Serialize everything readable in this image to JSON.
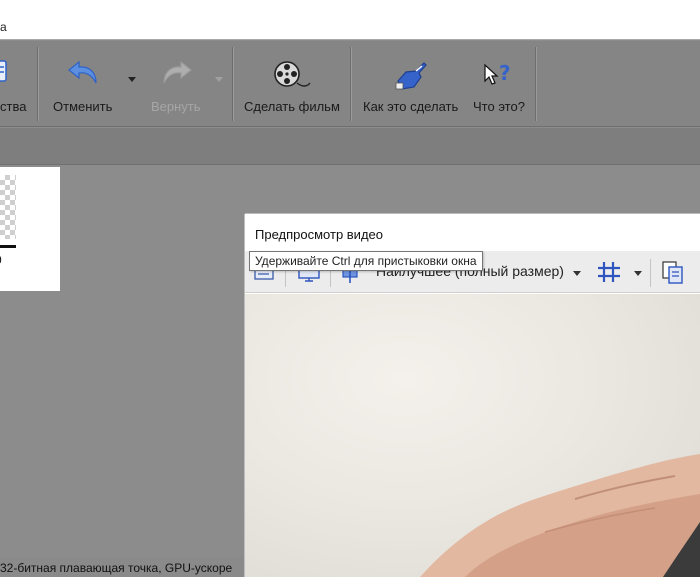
{
  "window": {
    "title_fragment": "а"
  },
  "ribbon": {
    "properties_label_fragment": "ства",
    "undo_label": "Отменить",
    "redo_label": "Вернуть",
    "make_movie_label": "Сделать фильм",
    "how_to_label": "Как это сделать",
    "whats_this_label": "Что это?",
    "icons": [
      "properties-icon",
      "undo-icon",
      "redo-icon",
      "film-reel-icon",
      "pointing-hand-icon",
      "help-cursor-icon"
    ]
  },
  "thumbnail": {
    "number_fragment": "0"
  },
  "status_bar": {
    "text": "32-битная плавающая точка, GPU-ускоре"
  },
  "preview": {
    "title": "Предпросмотр видео",
    "quality_selected": "Наилучшее (полный размер)",
    "icons": [
      "preview-settings-icon",
      "external-monitor-icon",
      "split-screen-icon",
      "grid-overlay-icon",
      "copy-frame-icon"
    ]
  },
  "tooltip": {
    "text": "Удерживайте Ctrl для пристыковки окна"
  },
  "colors": {
    "app_background": "#8c8c8c",
    "ribbon": "#858585",
    "icon_blue": "#2e62c8",
    "grid_blue": "#2f55c0"
  }
}
